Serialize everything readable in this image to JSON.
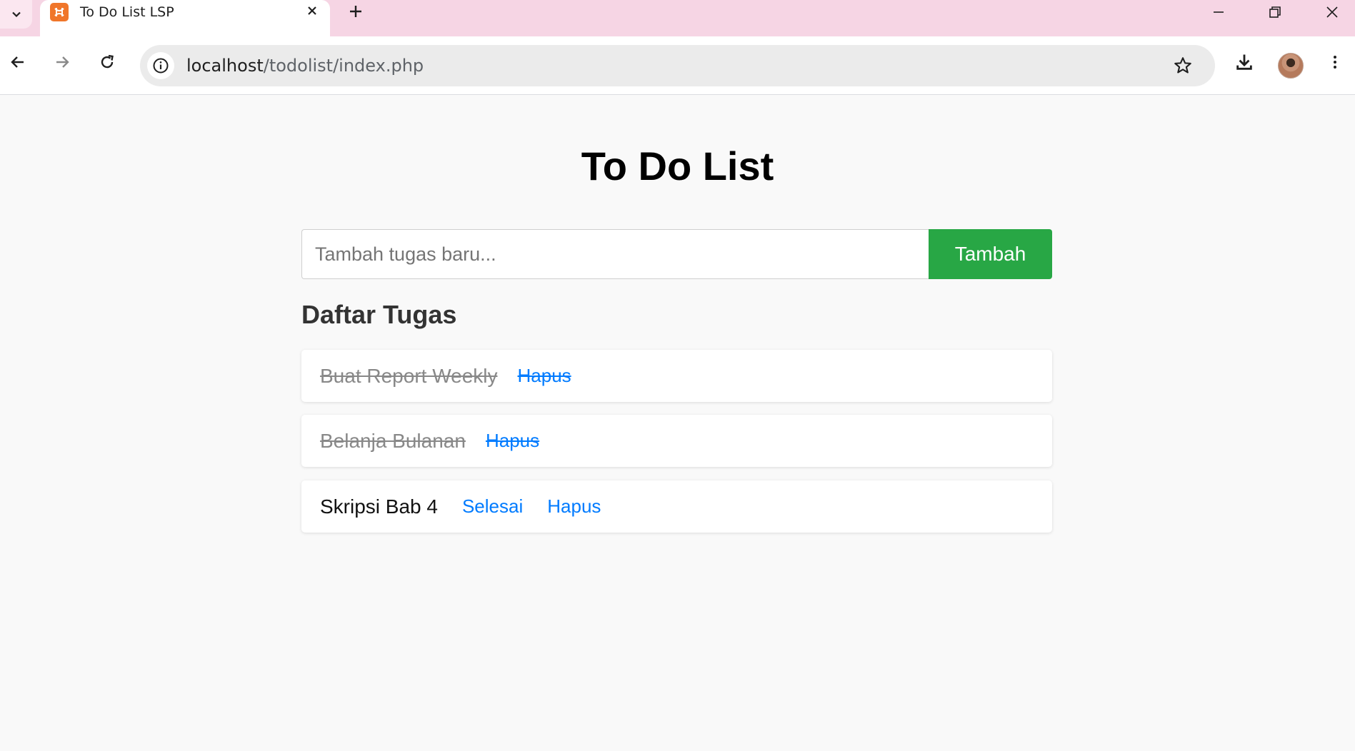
{
  "browser": {
    "tab_title": "To Do List LSP",
    "url_host": "localhost",
    "url_path": "/todolist/index.php"
  },
  "page": {
    "title": "To Do List",
    "input_placeholder": "Tambah tugas baru...",
    "add_button_label": "Tambah",
    "list_heading": "Daftar Tugas",
    "accent_color": "#28a745",
    "link_color": "#007bff"
  },
  "tasks": [
    {
      "text": "Buat Report Weekly",
      "done": true,
      "delete_label": "Hapus"
    },
    {
      "text": "Belanja Bulanan",
      "done": true,
      "delete_label": "Hapus"
    },
    {
      "text": "Skripsi Bab 4",
      "done": false,
      "complete_label": "Selesai",
      "delete_label": "Hapus"
    }
  ]
}
